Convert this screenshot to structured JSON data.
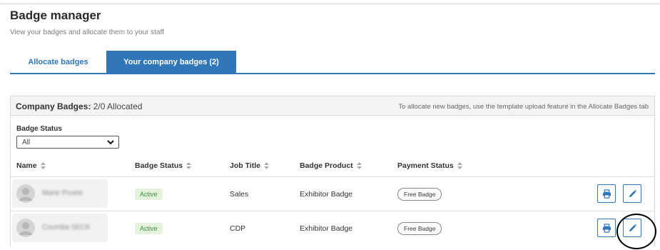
{
  "page": {
    "title": "Badge manager",
    "subtitle": "View your badges and allocate them to your staff"
  },
  "tabs": [
    {
      "label": "Allocate badges",
      "active": false
    },
    {
      "label": "Your company badges (2)",
      "active": true
    }
  ],
  "panel": {
    "header_label": "Company Badges:",
    "header_value": "2/0 Allocated",
    "header_hint": "To allocate new badges, use the template upload feature in the Allocate Badges tab"
  },
  "filter": {
    "label": "Badge Status",
    "selected": "All"
  },
  "columns": {
    "name": "Name",
    "badge_status": "Badge Status",
    "job_title": "Job Title",
    "badge_product": "Badge Product",
    "payment_status": "Payment Status"
  },
  "rows": [
    {
      "name": "Marie Pruete",
      "badge_status": "Active",
      "job_title": "Sales",
      "badge_product": "Exhibitor Badge",
      "payment_status": "Free Badge"
    },
    {
      "name": "Coumba SECK",
      "badge_status": "Active",
      "job_title": "CDP",
      "badge_product": "Exhibitor Badge",
      "payment_status": "Free Badge"
    }
  ],
  "icons": {
    "print": "print-icon",
    "edit": "pencil-icon",
    "sort": "sort-icon",
    "select": "chevron-down-icon",
    "avatar": "user-icon"
  },
  "colors": {
    "accent": "#2f77b8",
    "active_text": "#3f8f3f",
    "active_bg": "#e3f3dc"
  }
}
